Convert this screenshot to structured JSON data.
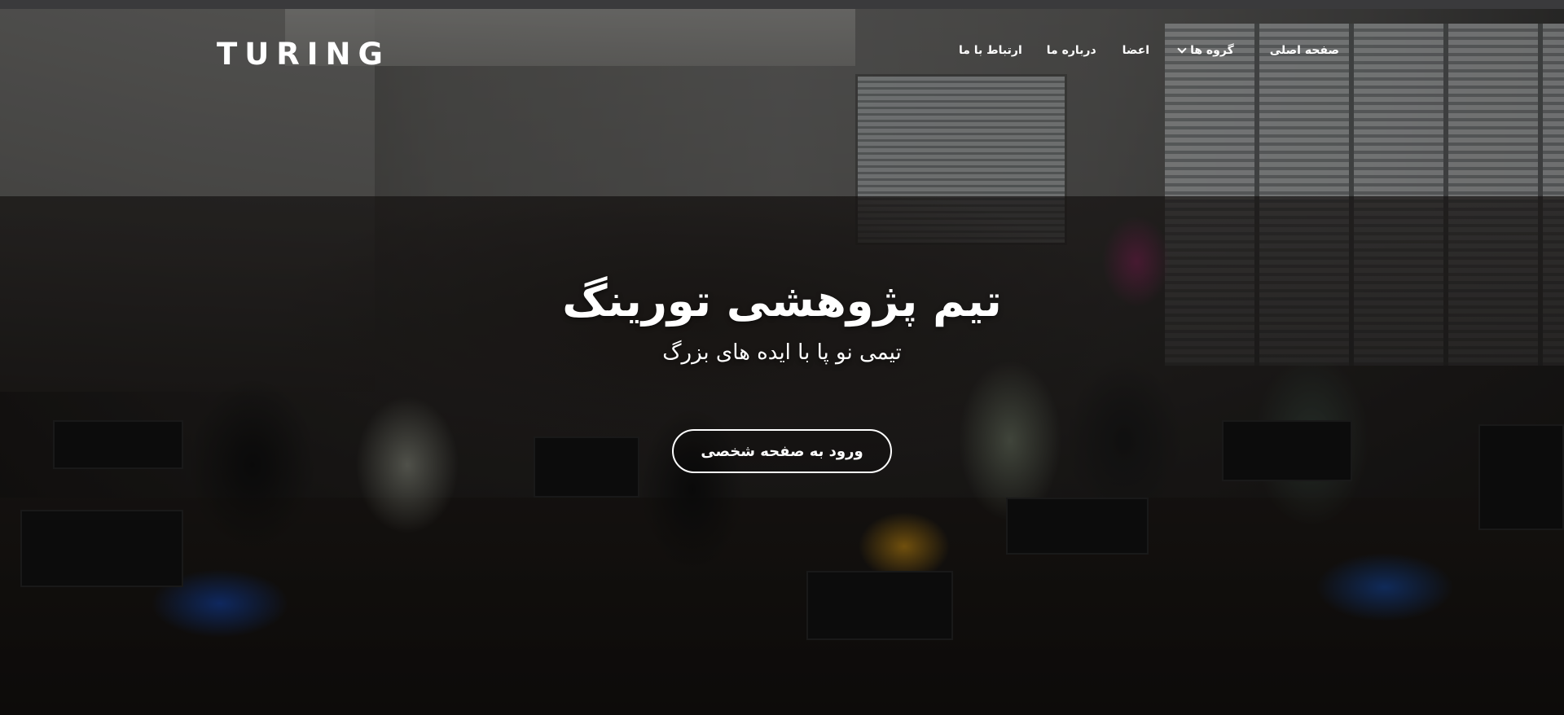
{
  "header": {
    "logo_text": "TURING",
    "nav": [
      {
        "label": "صفحه اصلی",
        "has_dropdown": false
      },
      {
        "label": "گروه ها",
        "has_dropdown": true
      },
      {
        "label": "اعضا",
        "has_dropdown": false
      },
      {
        "label": "درباره ما",
        "has_dropdown": false
      },
      {
        "label": "ارتباط با ما",
        "has_dropdown": false
      }
    ]
  },
  "hero": {
    "title": "تیم پژوهشی تورینگ",
    "subtitle": "تیمی نو پا با ایده های بزرگ",
    "cta_label": "ورود به صفحه شخصی"
  },
  "colors": {
    "text": "#ffffff",
    "overlay": "#000000"
  }
}
